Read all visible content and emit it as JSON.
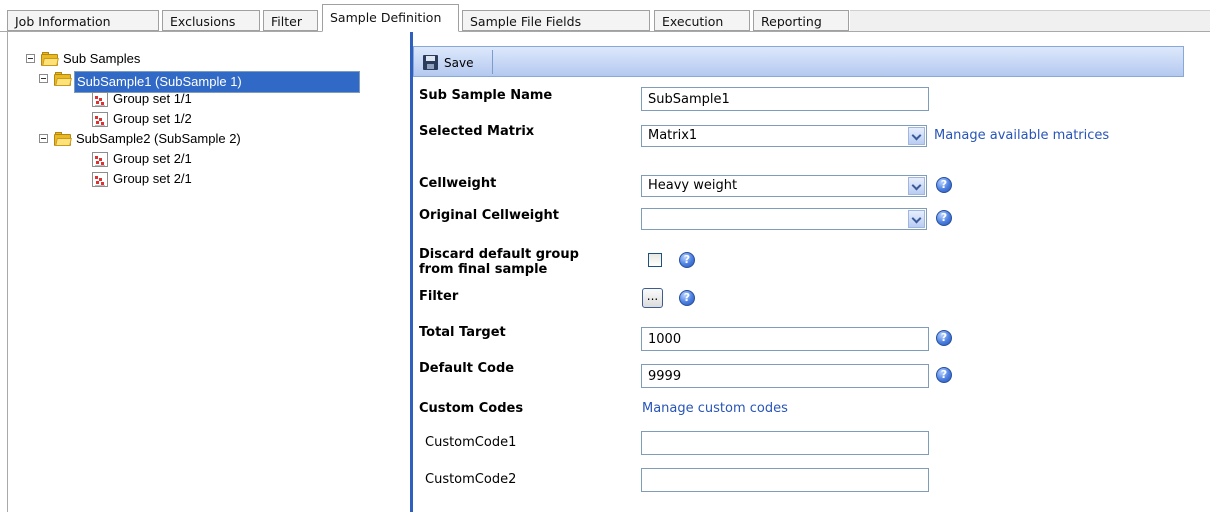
{
  "tabs": [
    {
      "label": "Job Information",
      "active": false
    },
    {
      "label": "Exclusions",
      "active": false
    },
    {
      "label": "Filter",
      "active": false
    },
    {
      "label": "Sample Definition",
      "active": true
    },
    {
      "label": "Sample File Fields",
      "active": false
    },
    {
      "label": "Execution",
      "active": false
    },
    {
      "label": "Reporting",
      "active": false
    }
  ],
  "tree": {
    "root": "Sub Samples",
    "subsamples": [
      {
        "label": "SubSample1 (SubSample 1)",
        "selected": true,
        "groups": [
          "Group set 1/1",
          "Group set 1/2"
        ]
      },
      {
        "label": "SubSample2 (SubSample 2)",
        "selected": false,
        "groups": [
          "Group set 2/1",
          "Group set 2/1"
        ]
      }
    ]
  },
  "toolbar": {
    "save_label": "Save"
  },
  "form": {
    "sub_sample_name": {
      "label": "Sub Sample Name",
      "value": "SubSample1"
    },
    "selected_matrix": {
      "label": "Selected Matrix",
      "value": "Matrix1",
      "link": "Manage available matrices"
    },
    "cellweight": {
      "label": "Cellweight",
      "value": "Heavy weight"
    },
    "original_cellweight": {
      "label": "Original Cellweight",
      "value": ""
    },
    "discard_default": {
      "label_line1": "Discard default group",
      "label_line2": "from final sample",
      "checked": false
    },
    "filter": {
      "label": "Filter",
      "button": "..."
    },
    "total_target": {
      "label": "Total Target",
      "value": "1000"
    },
    "default_code": {
      "label": "Default Code",
      "value": "9999"
    },
    "custom_codes": {
      "label": "Custom Codes",
      "link": "Manage custom codes"
    },
    "custom_code1": {
      "label": "CustomCode1",
      "value": ""
    },
    "custom_code2": {
      "label": "CustomCode2",
      "value": ""
    }
  },
  "help_glyph": "?",
  "colors": {
    "accent": "#2f5fbf",
    "selection": "#3169c6",
    "link": "#2855b8"
  }
}
